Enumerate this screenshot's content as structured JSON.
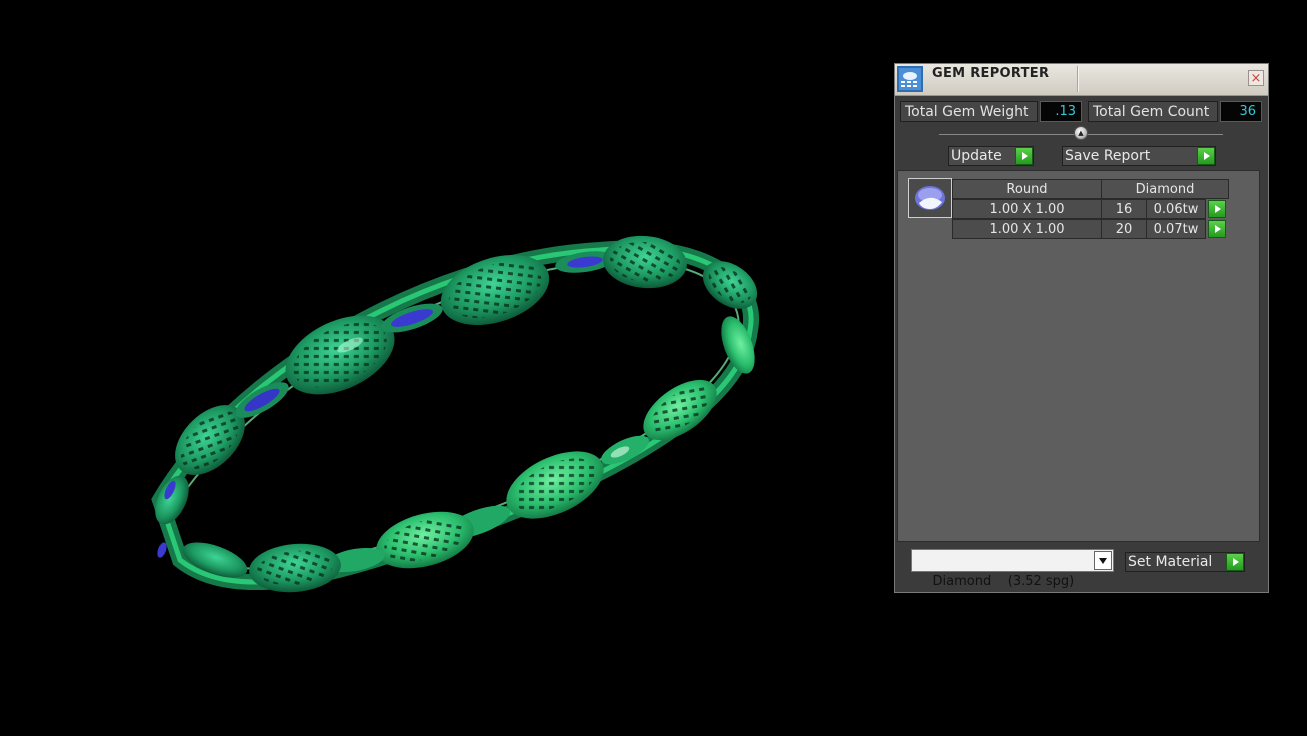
{
  "gem_reporter": {
    "title": "GEM REPORTER",
    "close_symbol": "×",
    "total_weight_label": "Total Gem Weight",
    "total_weight_value": ".13",
    "total_count_label": "Total Gem Count",
    "total_count_value": "36",
    "update_label": "Update",
    "save_report_label": "Save Report",
    "table": {
      "shape": "Round",
      "material": "Diamond",
      "rows": [
        {
          "size": "1.00 X 1.00",
          "count": "16",
          "weight": "0.06tw"
        },
        {
          "size": "1.00 X 1.00",
          "count": "20",
          "weight": "0.07tw"
        }
      ]
    },
    "material_select_value": "Diamond    (3.52 spg)",
    "set_material_label": "Set Material"
  },
  "icons": {
    "app": "gem-reporter-app-icon",
    "close": "close-icon",
    "gem": "round-gem-icon",
    "go": "green-play-arrow-icon",
    "dropdown": "chevron-down-icon",
    "slider": "slider-knob"
  },
  "colors": {
    "viewport_bg": "#000000",
    "panel_bg": "#3b3b3b",
    "value_text": "#34c9d6",
    "go_button": "#3cb832",
    "ring_green": "#1fa56a",
    "gem_blue": "#3a3ad0"
  }
}
